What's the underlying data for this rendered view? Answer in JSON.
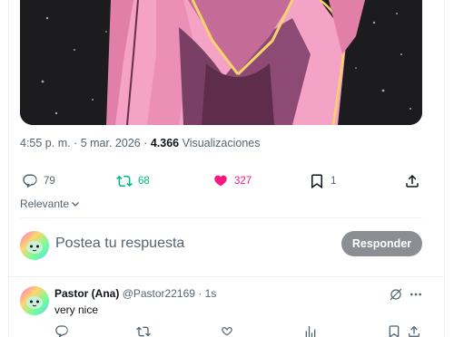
{
  "post": {
    "time": "4:55 p. m.",
    "separator": " · ",
    "date": "5 mar. 2026",
    "views_count": "4.366",
    "views_label": " Visualizaciones"
  },
  "actions": {
    "replies": "79",
    "retweets": "68",
    "likes": "327",
    "bookmarks": "1"
  },
  "sort": {
    "label": "Relevante"
  },
  "compose": {
    "placeholder": "Postea tu respuesta",
    "button_label": "Responder"
  },
  "reply": {
    "name": "Pastor (Ana)",
    "handle": "@Pastor22169",
    "separator": " · ",
    "time": "1s",
    "text": "very nice"
  },
  "colors": {
    "retweet": "#00ba7c",
    "like": "#f91880",
    "muted": "#536471",
    "reply_button": "#8b8f93"
  },
  "icons": [
    "reply-icon",
    "retweet-icon",
    "heart-icon",
    "bookmark-icon",
    "share-icon",
    "chevron-down-icon",
    "grok-icon",
    "more-icon",
    "views-icon"
  ]
}
